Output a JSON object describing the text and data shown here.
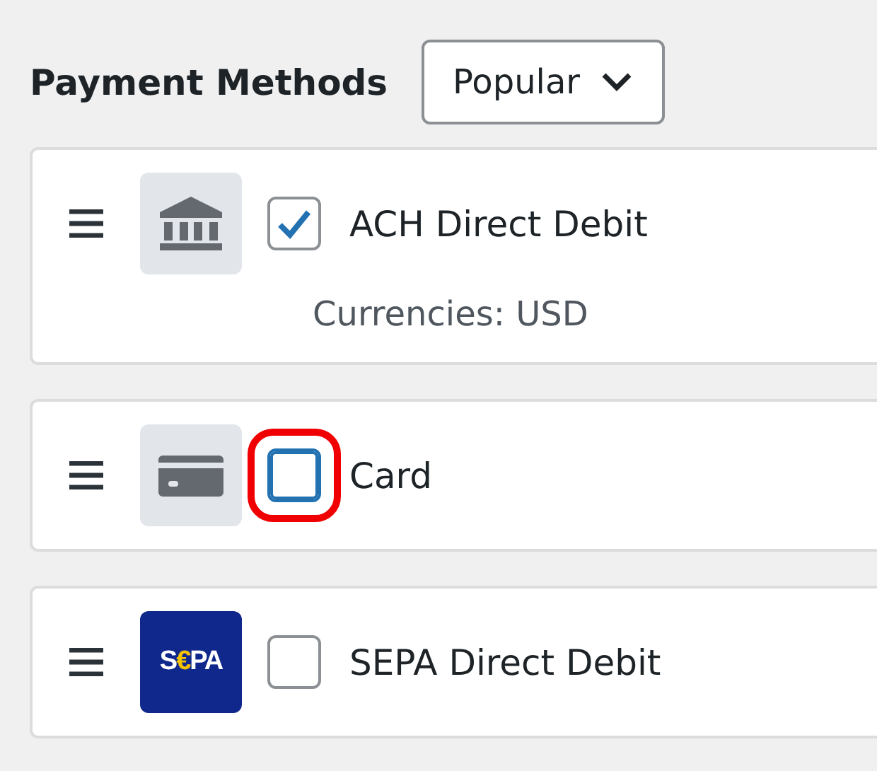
{
  "header": {
    "title": "Payment Methods",
    "filter": {
      "value": "Popular"
    }
  },
  "methods": [
    {
      "name": "ACH Direct Debit",
      "icon": {
        "kind": "bank"
      },
      "checked": true,
      "focused": false,
      "highlighted": false,
      "details": "Currencies: USD"
    },
    {
      "name": "Card",
      "icon": {
        "kind": "card"
      },
      "checked": false,
      "focused": true,
      "highlighted": true
    },
    {
      "name": "SEPA Direct Debit",
      "icon": {
        "kind": "logo",
        "parts": [
          {
            "text": "S",
            "accent": false
          },
          {
            "text": "€",
            "accent": true
          },
          {
            "text": "PA",
            "accent": false
          }
        ]
      },
      "checked": false,
      "focused": false,
      "highlighted": false
    }
  ]
}
